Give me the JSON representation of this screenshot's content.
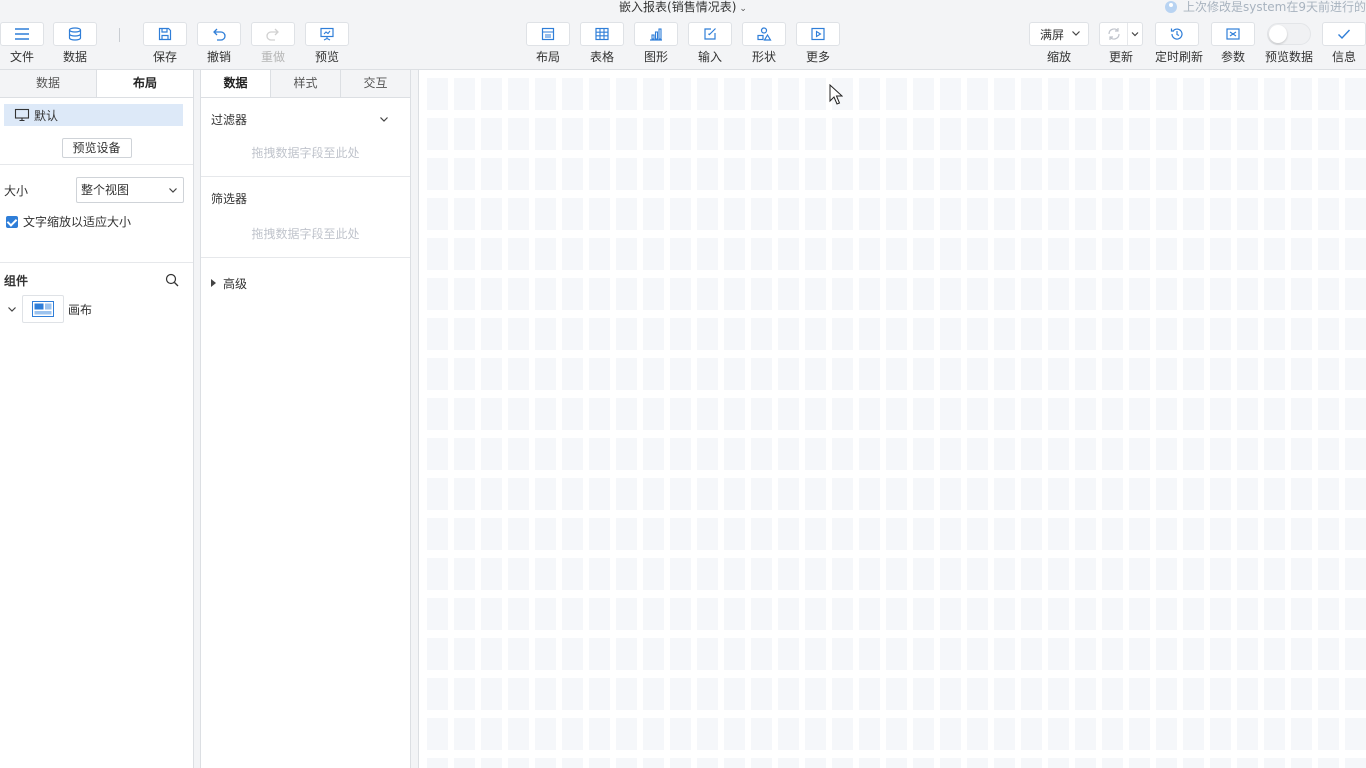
{
  "title": "嵌入报表(销售情况表)",
  "last_modified": "上次修改是system在9天前进行的",
  "toolbar": {
    "file": "文件",
    "data": "数据",
    "save": "保存",
    "undo": "撤销",
    "redo": "重做",
    "preview": "预览",
    "layout": "布局",
    "table": "表格",
    "graph": "图形",
    "input": "输入",
    "shape": "形状",
    "more": "更多",
    "zoom_value": "满屏",
    "zoom_label": "缩放",
    "update": "更新",
    "timed_refresh": "定时刷新",
    "params": "参数",
    "preview_data": "预览数据",
    "info": "信息"
  },
  "left_panel": {
    "tabs": [
      "数据",
      "布局"
    ],
    "active_tab": "布局",
    "device": "默认",
    "preview_device": "预览设备",
    "size_label": "大小",
    "size_value": "整个视图",
    "fit_text": "文字缩放以适应大小",
    "components_title": "组件",
    "canvas_item": "画布"
  },
  "mid_panel": {
    "tabs": [
      "数据",
      "样式",
      "交互"
    ],
    "active_tab": "数据",
    "filter": "过滤器",
    "filter_hint": "拖拽数据字段至此处",
    "selector": "筛选器",
    "selector_hint": "拖拽数据字段至此处",
    "advanced": "高级"
  },
  "colors": {
    "accent": "#2f7ed8",
    "selected_row": "#dde9f8",
    "toolbar_bg": "#f3f4f6"
  }
}
